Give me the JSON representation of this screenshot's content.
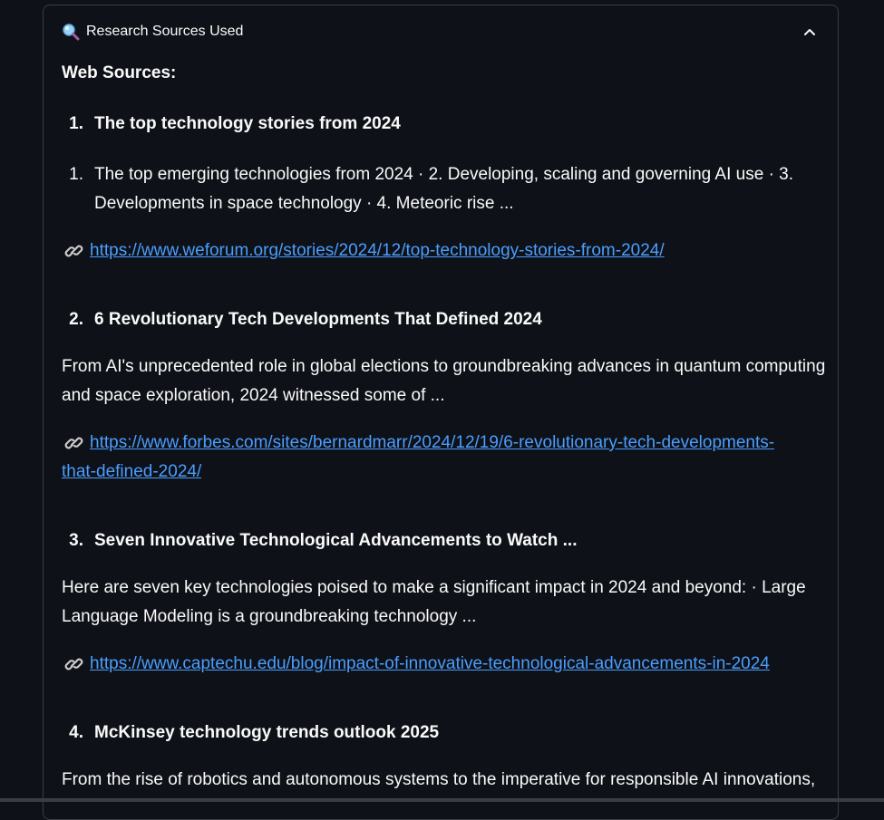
{
  "expander": {
    "title": "Research Sources Used",
    "icon": "magnifier-icon",
    "toggle_icon": "chevron-up-icon"
  },
  "heading": "Web Sources:",
  "sources": [
    {
      "number": "1.",
      "title": "The top technology stories from 2024",
      "snippet_number": "1.",
      "snippet_lines": [
        "The top emerging technologies from 2024 · 2. Developing, scaling and governing AI use · 3.",
        "Developments in space technology · 4. Meteoric rise ..."
      ],
      "url_lines": [
        "https://www.weforum.org/stories/2024/12/top-technology-stories-from-2024/"
      ]
    },
    {
      "number": "2.",
      "title": "6 Revolutionary Tech Developments That Defined 2024",
      "snippet_lines": [
        "From AI's unprecedented role in global elections to groundbreaking advances in quantum computing",
        "and space exploration, 2024 witnessed some of ..."
      ],
      "url_lines": [
        "https://www.forbes.com/sites/bernardmarr/2024/12/19/6-revolutionary-tech-developments-",
        "that-defined-2024/"
      ]
    },
    {
      "number": "3.",
      "title": "Seven Innovative Technological Advancements to Watch ...",
      "snippet_lines": [
        "Here are seven key technologies poised to make a significant impact in 2024 and beyond: · Large",
        "Language Modeling is a groundbreaking technology ..."
      ],
      "url_lines": [
        "https://www.captechu.edu/blog/impact-of-innovative-technological-advancements-in-2024"
      ]
    },
    {
      "number": "4.",
      "title": "McKinsey technology trends outlook 2025",
      "snippet_lines": [
        "From the rise of robotics and autonomous systems to the imperative for responsible AI innovations,"
      ]
    }
  ],
  "colors": {
    "background": "#0e1117",
    "text": "#fafafa",
    "link": "#4a9eff",
    "border": "#3a3d45"
  }
}
